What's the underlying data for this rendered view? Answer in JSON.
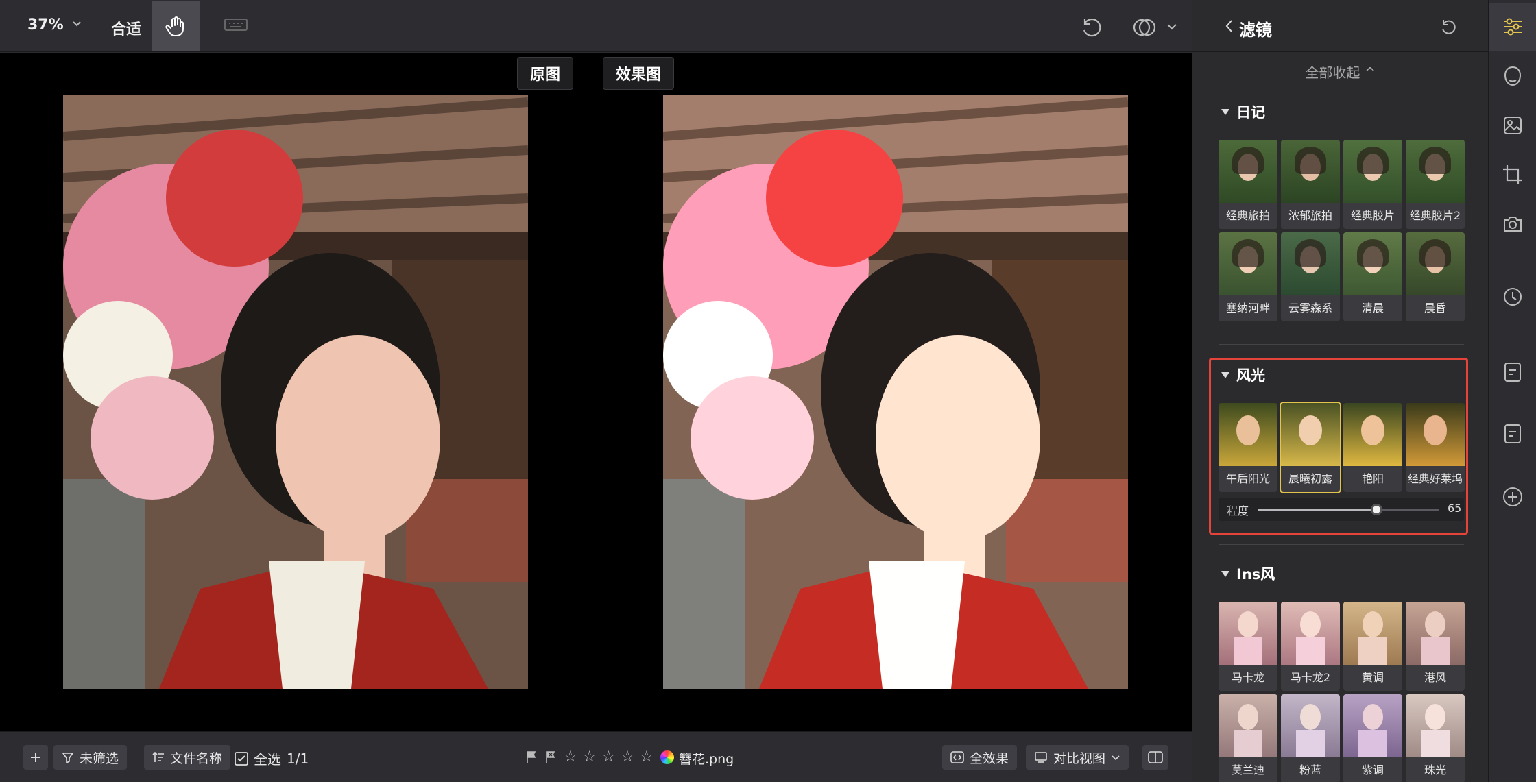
{
  "toolbar": {
    "zoom": "37%",
    "fit": "合适"
  },
  "canvas": {
    "original_label": "原图",
    "effect_label": "效果图"
  },
  "panel": {
    "title": "滤镜",
    "collapse_all": "全部收起 ^",
    "sections": [
      {
        "name": "日记",
        "items": [
          "经典旅拍",
          "浓郁旅拍",
          "经典胶片",
          "经典胶片2",
          "塞纳河畔",
          "云雾森系",
          "清晨",
          "晨昏"
        ]
      },
      {
        "name": "风光",
        "items": [
          "午后阳光",
          "晨曦初露",
          "艳阳",
          "经典好莱坞"
        ],
        "selected": 1
      },
      {
        "name": "Ins风",
        "items": [
          "马卡龙",
          "马卡龙2",
          "黄调",
          "港风",
          "莫兰迪",
          "粉蓝",
          "紫调",
          "珠光"
        ]
      }
    ],
    "slider": {
      "label": "程度",
      "value": "65",
      "level": 0.65
    }
  },
  "bottombar": {
    "unfiltered": "未筛选",
    "file_name_sort": "文件名称",
    "select_all": "全选",
    "count": "1/1",
    "filename": "簪花.png",
    "full_effect": "全效果",
    "compare_view": "对比视图"
  },
  "colors": {
    "accent": "#e3c44f",
    "highlight": "#e5443a",
    "bg": "#2b2b2e"
  }
}
